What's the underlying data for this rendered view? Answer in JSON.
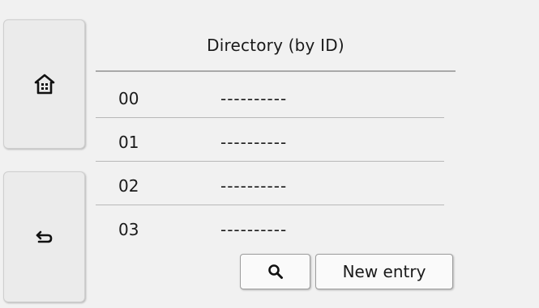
{
  "header": {
    "title": "Directory (by ID)"
  },
  "nav": {
    "home_icon": "home-icon",
    "back_icon": "back-arrow-icon"
  },
  "directory": {
    "entries": [
      {
        "id": "00",
        "name": "----------"
      },
      {
        "id": "01",
        "name": "----------"
      },
      {
        "id": "02",
        "name": "----------"
      },
      {
        "id": "03",
        "name": "----------"
      }
    ]
  },
  "actions": {
    "search_icon": "search-icon",
    "new_entry_label": "New entry"
  }
}
